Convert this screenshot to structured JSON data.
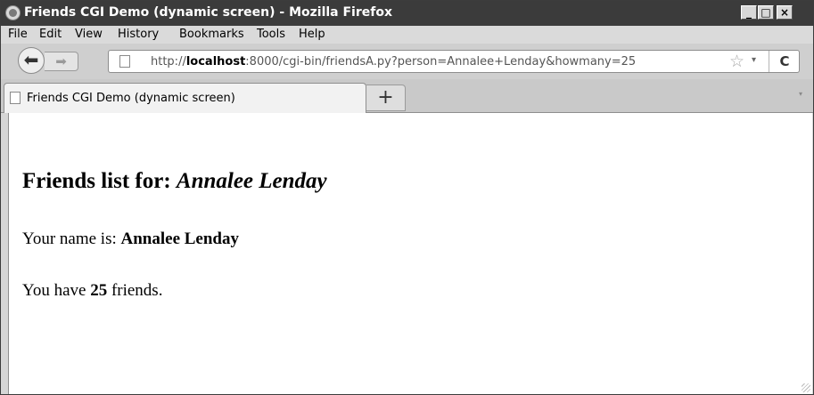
{
  "window": {
    "title": "Friends CGI Demo (dynamic screen) - Mozilla Firefox",
    "icon": "firefox-icon",
    "controls": {
      "minimize": "_",
      "maximize": "□",
      "close": "×"
    }
  },
  "menu": [
    "File",
    "Edit",
    "View",
    "History",
    "Bookmarks",
    "Tools",
    "Help"
  ],
  "nav": {
    "back": "⬅",
    "forward": "➡",
    "url_prefix": "http://",
    "url_host": "localhost",
    "url_rest": ":8000/cgi-bin/friendsA.py?person=Annalee+Lenday&howmany=25",
    "star": "☆",
    "dropdown": "▾",
    "reload": "C"
  },
  "tab": {
    "title": "Friends CGI Demo (dynamic screen)",
    "new_tab": "+",
    "list_arrow": "▾"
  },
  "page": {
    "heading_label": "Friends list for: ",
    "heading_name": "Annalee Lenday",
    "name_label": "Your name is: ",
    "name_value": "Annalee Lenday",
    "friends_prefix": "You have ",
    "friends_count": "25",
    "friends_suffix": " friends."
  }
}
